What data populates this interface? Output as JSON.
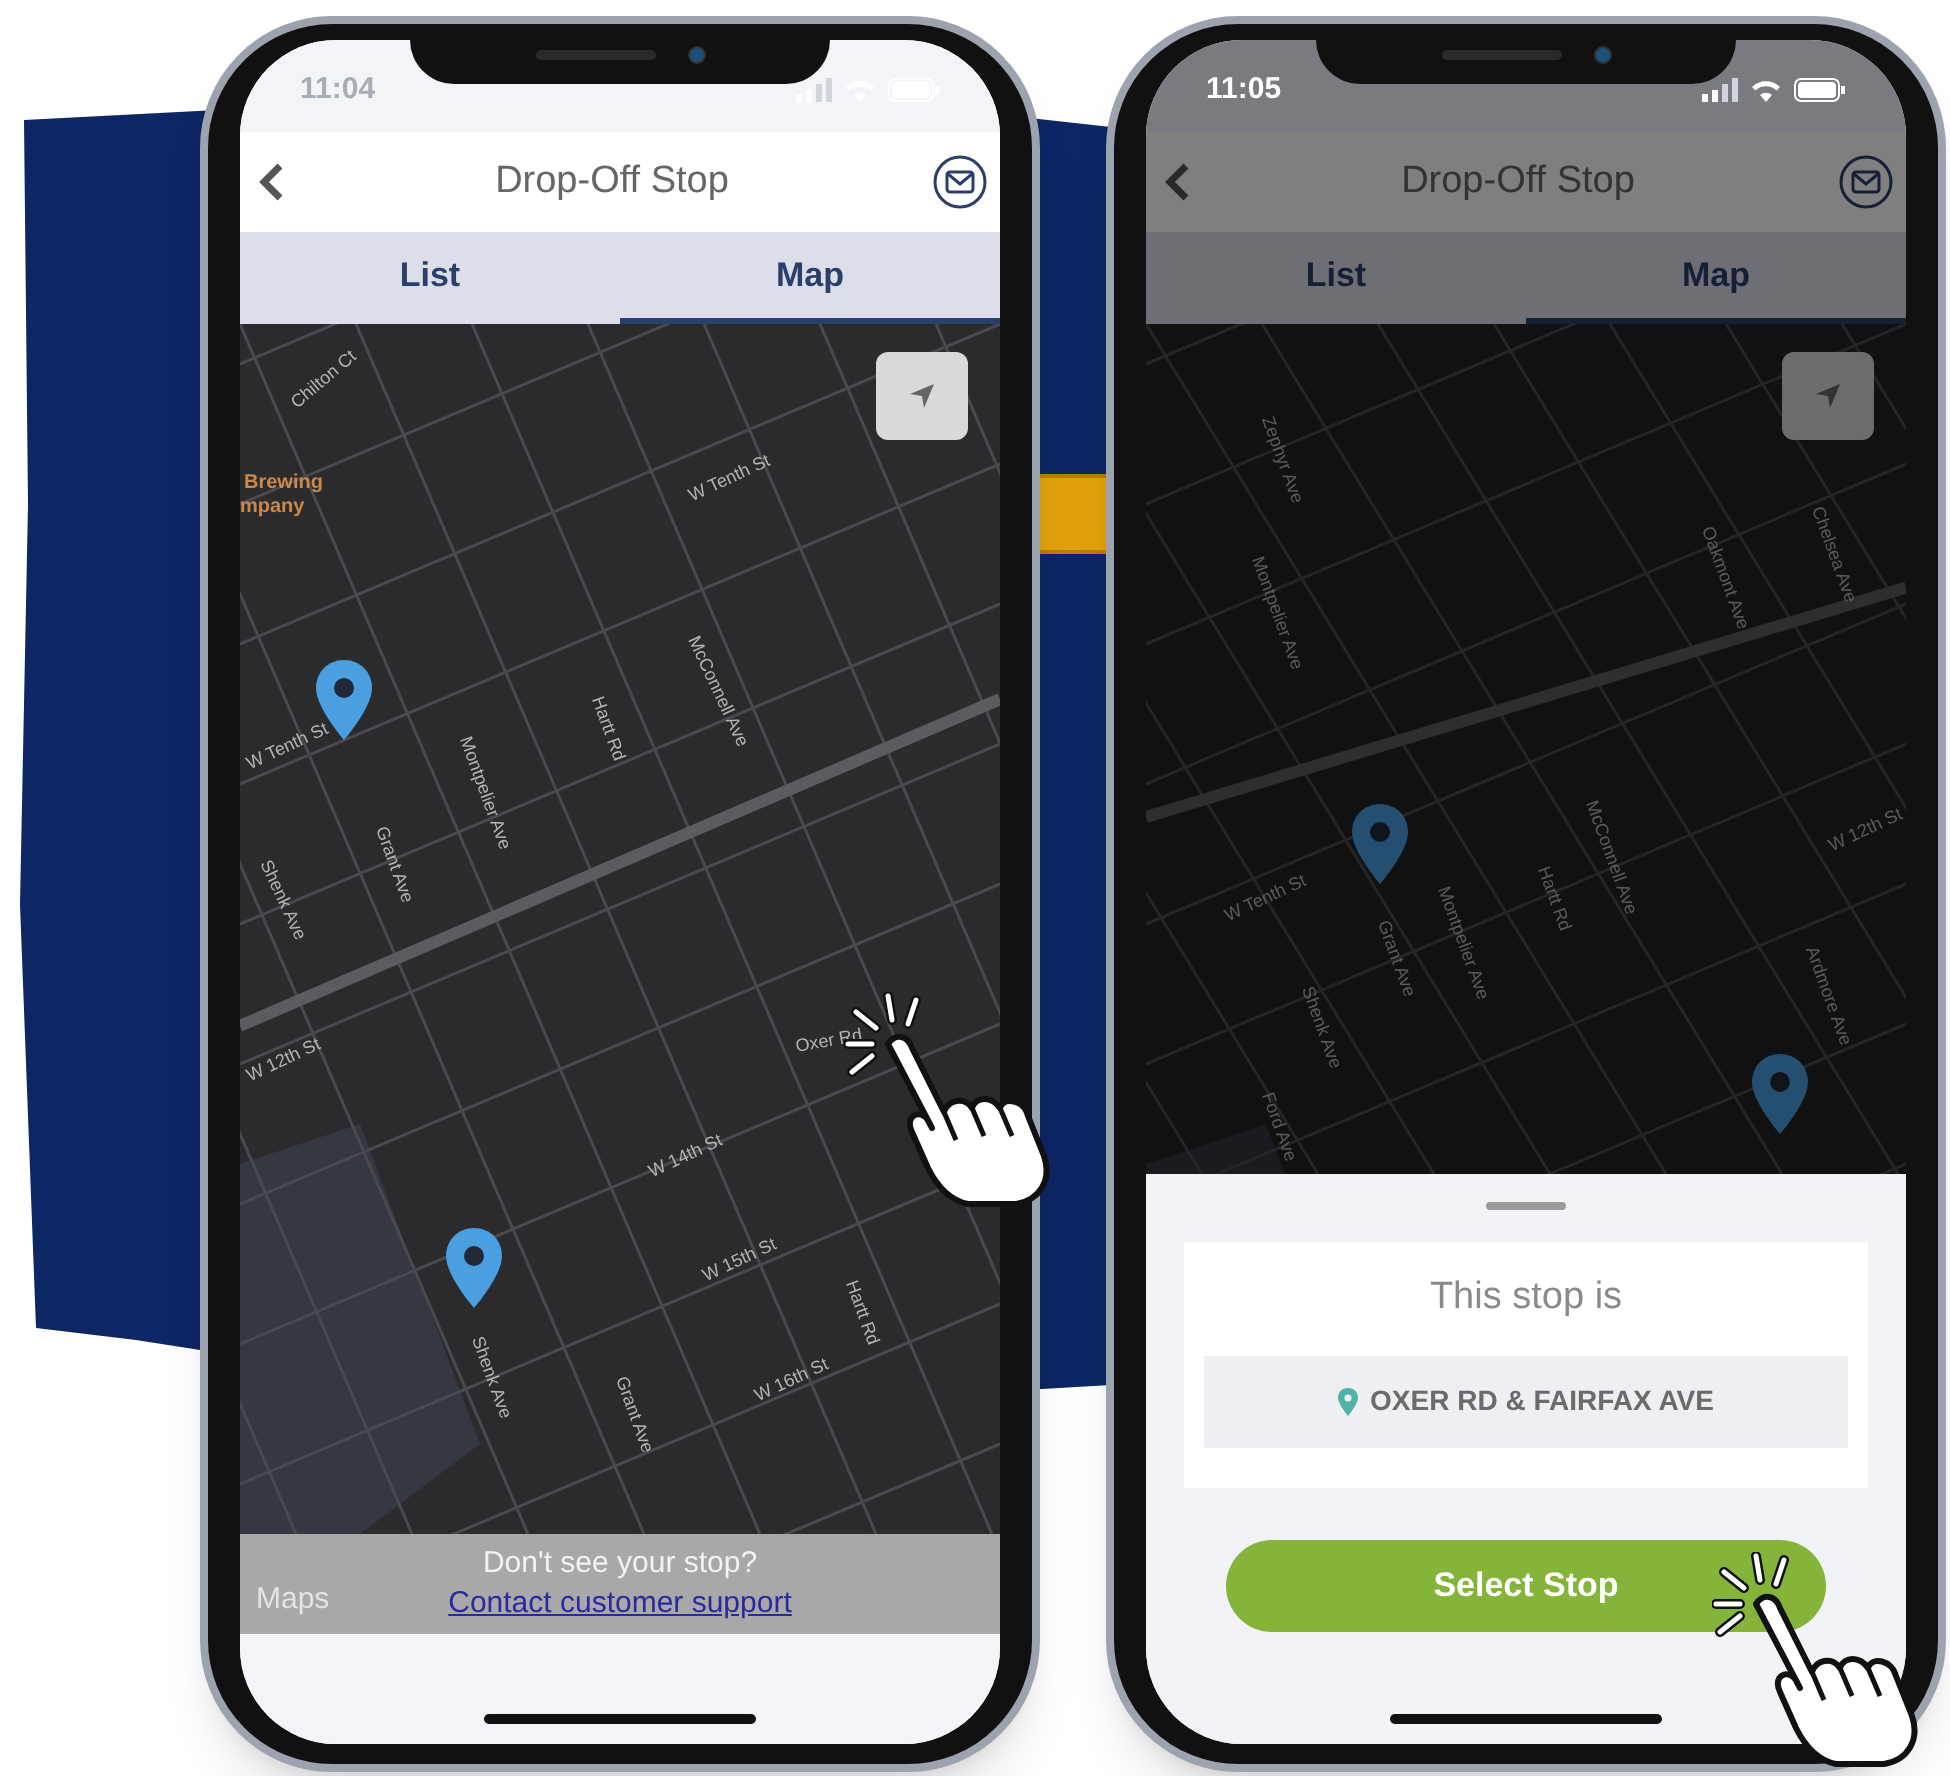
{
  "phones": [
    {
      "time": "11:04",
      "title": "Drop-Off Stop",
      "tabs": [
        {
          "label": "List",
          "selected": false
        },
        {
          "label": "Map",
          "selected": true
        }
      ],
      "dimmed": false,
      "map_labels": [
        "Chilton Ct",
        "Brewing",
        "mpany",
        "W Tenth St",
        "W Tenth St",
        "McConnell Ave",
        "Hartt Rd",
        "Montpelier Ave",
        "Grant Ave",
        "Shenk Ave",
        "W 12th St",
        "Oxer Rd",
        "W 14th St",
        "W 15th St",
        "Hartt Rd",
        "Shenk Ave",
        "Grant Ave",
        "W 16th St"
      ],
      "footer": {
        "text": "Don't see your stop?",
        "link": "Contact customer support",
        "attribution": "Maps"
      }
    },
    {
      "time": "11:05",
      "title": "Drop-Off Stop",
      "tabs": [
        {
          "label": "List",
          "selected": false
        },
        {
          "label": "Map",
          "selected": true
        }
      ],
      "dimmed": true,
      "map_labels": [
        "Zephyr Ave",
        "Montpelier Ave",
        "Oakmont Ave",
        "Chelsea Ave",
        "W Tenth St",
        "Grant Ave",
        "Montpelier Ave",
        "Hartt Rd",
        "McConnell Ave",
        "W 12th St",
        "Shenk Ave",
        "Ford Ave",
        "Ardmore Ave"
      ],
      "sheet": {
        "heading": "This stop is",
        "address": "OXER RD & FAIRFAX AVE",
        "button": "Select Stop"
      }
    }
  ]
}
